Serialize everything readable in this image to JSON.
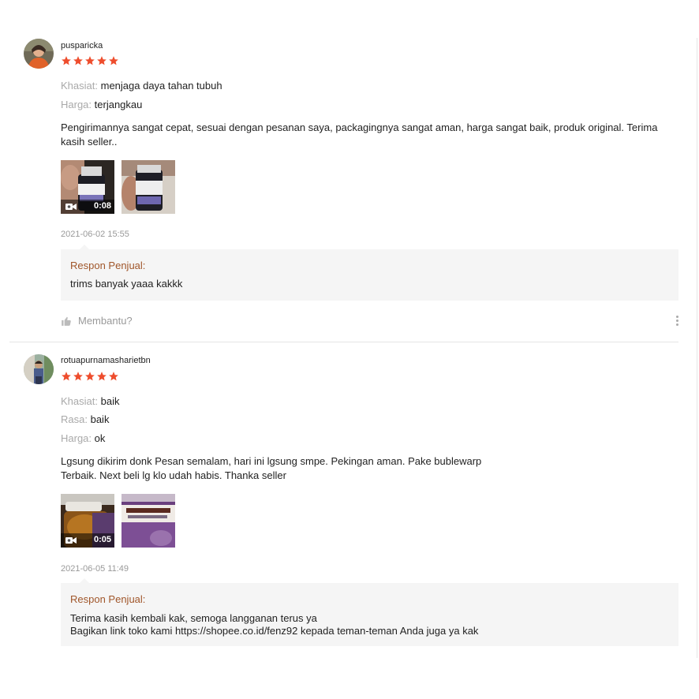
{
  "reviews": [
    {
      "username": "pusparicka",
      "rating": 5,
      "attributes": [
        {
          "key": "Khasiat:",
          "value": "menjaga daya tahan tubuh"
        },
        {
          "key": "Harga:",
          "value": "terjangkau"
        }
      ],
      "comment_lines": [
        "Pengirimannya sangat cepat, sesuai dengan pesanan saya, packagingnya sangat aman, harga sangat baik, produk original. Terima",
        "kasih seller.."
      ],
      "media": [
        {
          "type": "video",
          "duration": "0:08"
        },
        {
          "type": "image"
        }
      ],
      "date": "2021-06-02 15:55",
      "seller_reply": {
        "label": "Respon Penjual:",
        "lines": [
          "trims banyak yaaa kakkk"
        ]
      },
      "helpful_label": "Membantu?"
    },
    {
      "username": "rotuapurnamasharietbn",
      "rating": 5,
      "attributes": [
        {
          "key": "Khasiat:",
          "value": "baik"
        },
        {
          "key": "Rasa:",
          "value": "baik"
        },
        {
          "key": "Harga:",
          "value": "ok"
        }
      ],
      "comment_lines": [
        "Lgsung dikirim donk Pesan semalam, hari ini lgsung smpe. Pekingan aman. Pake bublewarp",
        "Terbaik. Next beli lg klo udah habis. Thanka seller"
      ],
      "media": [
        {
          "type": "video",
          "duration": "0:05"
        },
        {
          "type": "image"
        }
      ],
      "date": "2021-06-05 11:49",
      "seller_reply": {
        "label": "Respon Penjual:",
        "lines": [
          "Terima kasih kembali kak, semoga langganan terus ya",
          "Bagikan link toko kami https://shopee.co.id/fenz92 kepada teman-teman Anda juga ya kak"
        ]
      }
    }
  ],
  "colors": {
    "star": "#ee4d2d",
    "reply_label": "#a0562a",
    "reply_background": "#f5f5f5",
    "muted_text": "#999999"
  },
  "icons": {
    "star": "star-icon",
    "video": "video-camera-icon",
    "helpful": "thumbs-up-icon",
    "more": "more-vertical-icon"
  }
}
